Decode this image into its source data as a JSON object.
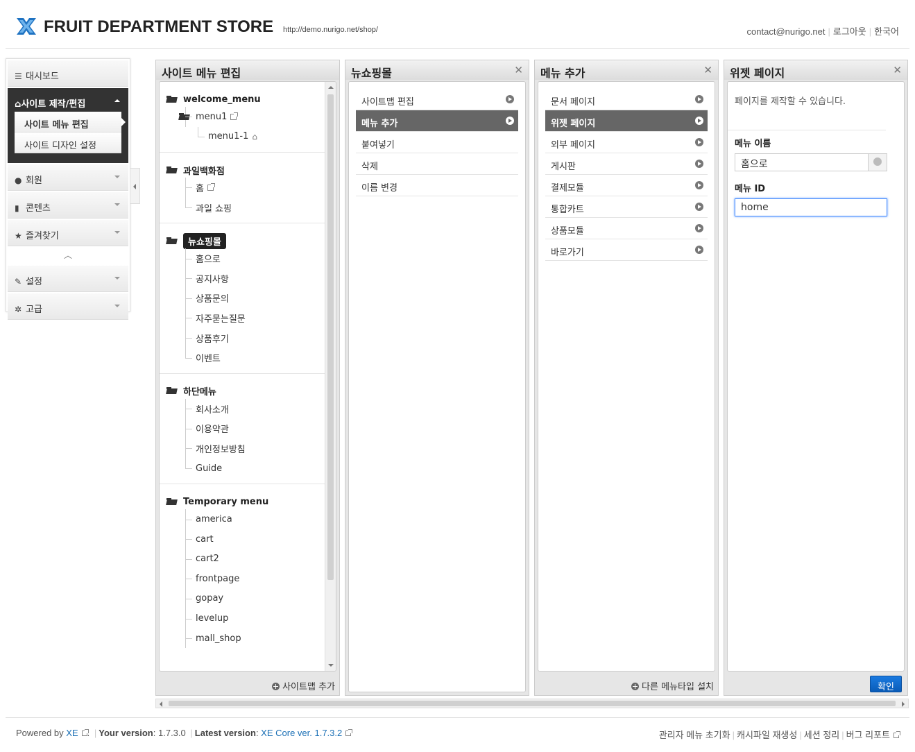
{
  "header": {
    "title": "FRUIT DEPARTMENT STORE",
    "url": "http://demo.nurigo.net/shop/",
    "links": [
      "contact@nurigo.net",
      "로그아웃",
      "한국어"
    ]
  },
  "sidebar": {
    "items": [
      {
        "label": "대시보드",
        "icon": "list-icon"
      },
      {
        "label": "사이트 제작/편집",
        "icon": "home-icon"
      },
      {
        "label": "회원",
        "icon": "user-icon"
      },
      {
        "label": "콘텐츠",
        "icon": "book-icon"
      },
      {
        "label": "즐겨찾기",
        "icon": "star-icon"
      },
      {
        "label": "설정",
        "icon": "wrench-icon"
      },
      {
        "label": "고급",
        "icon": "gear-icon"
      }
    ],
    "subitems": [
      "사이트 메뉴 편집",
      "사이트 디자인 설정"
    ]
  },
  "panel1": {
    "title": "사이트 메뉴 편집",
    "footer": "사이트맵 추가",
    "groups": [
      {
        "name": "welcome_menu",
        "children": [
          "menu1"
        ],
        "grandchildren": [
          "menu1-1"
        ]
      },
      {
        "name": "과일백화점",
        "children": [
          "홈",
          "과일 쇼핑"
        ]
      },
      {
        "name": "뉴쇼핑몰",
        "children": [
          "홈으로",
          "공지사항",
          "상품문의",
          "자주묻는질문",
          "상품후기",
          "이벤트"
        ]
      },
      {
        "name": "하단메뉴",
        "children": [
          "회사소개",
          "이용약관",
          "개인정보방침",
          "Guide"
        ]
      },
      {
        "name": "Temporary menu",
        "children": [
          "america",
          "cart",
          "cart2",
          "frontpage",
          "gopay",
          "levelup",
          "mall_shop"
        ]
      }
    ]
  },
  "panel2": {
    "title": "뉴쇼핑몰",
    "items": [
      "사이트맵 편집",
      "메뉴 추가",
      "붙여넣기",
      "삭제",
      "이름 변경"
    ]
  },
  "panel3": {
    "title": "메뉴 추가",
    "items": [
      "문서 페이지",
      "위젯 페이지",
      "외부 페이지",
      "게시판",
      "결제모듈",
      "통합카트",
      "상품모듈",
      "바로가기"
    ],
    "footer": "다른 메뉴타입 설치"
  },
  "panel4": {
    "title": "위젯 페이지",
    "description": "페이지를 제작할 수 있습니다.",
    "menu_name_label": "메뉴 이름",
    "menu_name_value": "홈으로",
    "menu_id_label": "메뉴 ID",
    "menu_id_value": "home",
    "confirm": "확인"
  },
  "footer": {
    "powered_prefix": "Powered by",
    "powered_link": "XE",
    "your_version_label": "Your version",
    "your_version": "1.7.3.0",
    "latest_version_label": "Latest version",
    "latest_version": "XE Core ver. 1.7.3.2",
    "links": [
      "관리자 메뉴 초기화",
      "캐시파일 재생성",
      "세션 정리",
      "버그 리포트"
    ]
  }
}
